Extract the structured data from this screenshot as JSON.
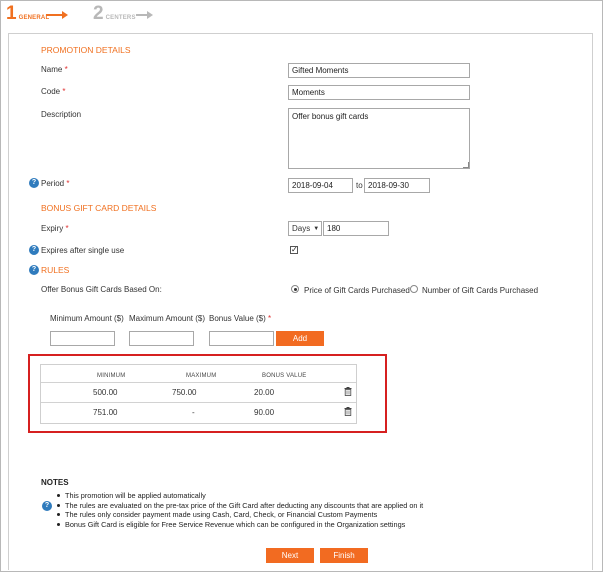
{
  "steps": [
    {
      "number": "1",
      "label": "GENERAL"
    },
    {
      "number": "2",
      "label": "CENTERS"
    }
  ],
  "promotion_details": {
    "heading": "PROMOTION DETAILS",
    "name_label": "Name",
    "name_value": "Gifted Moments",
    "code_label": "Code",
    "code_value": "Moments",
    "description_label": "Description",
    "description_value": "Offer bonus gift cards",
    "period_label": "Period",
    "period_from": "2018-09-04",
    "period_to_label": "to",
    "period_to": "2018-09-30",
    "required_mark": "*",
    "help_icon": "?"
  },
  "bonus_details": {
    "heading": "BONUS GIFT CARD DETAILS",
    "expiry_label": "Expiry",
    "expiry_unit": "Days",
    "expiry_value": "180",
    "expires_single_use_label": "Expires after single use",
    "expires_single_use_checked": true
  },
  "rules": {
    "heading": "RULES",
    "based_on_label": "Offer Bonus Gift Cards Based On:",
    "option_price": "Price of Gift Cards Purchased",
    "option_number": "Number of Gift Cards Purchased",
    "selected": "price",
    "min_label": "Minimum Amount ($)",
    "max_label": "Maximum Amount ($)",
    "bonus_label": "Bonus Value ($)",
    "add_button": "Add",
    "table": {
      "headers": [
        "MINIMUM",
        "MAXIMUM",
        "BONUS VALUE"
      ],
      "rows": [
        {
          "minimum": "500.00",
          "maximum": "750.00",
          "bonus": "20.00"
        },
        {
          "minimum": "751.00",
          "maximum": "-",
          "bonus": "90.00"
        }
      ]
    }
  },
  "notes": {
    "title": "NOTES",
    "items": [
      "This promotion will be applied automatically",
      "The rules are evaluated on the pre-tax price of the Gift Card after deducting any discounts that are applied on it",
      "The rules only consider payment made using Cash, Card, Check, or Financial Custom Payments",
      "Bonus Gift Card is eligible for Free Service Revenue which can be configured in the Organization settings"
    ]
  },
  "footer": {
    "next_button": "Next",
    "finish_button": "Finish"
  },
  "colors": {
    "accent": "#f26b21",
    "help": "#2f7bbd",
    "highlight": "#d62020"
  }
}
